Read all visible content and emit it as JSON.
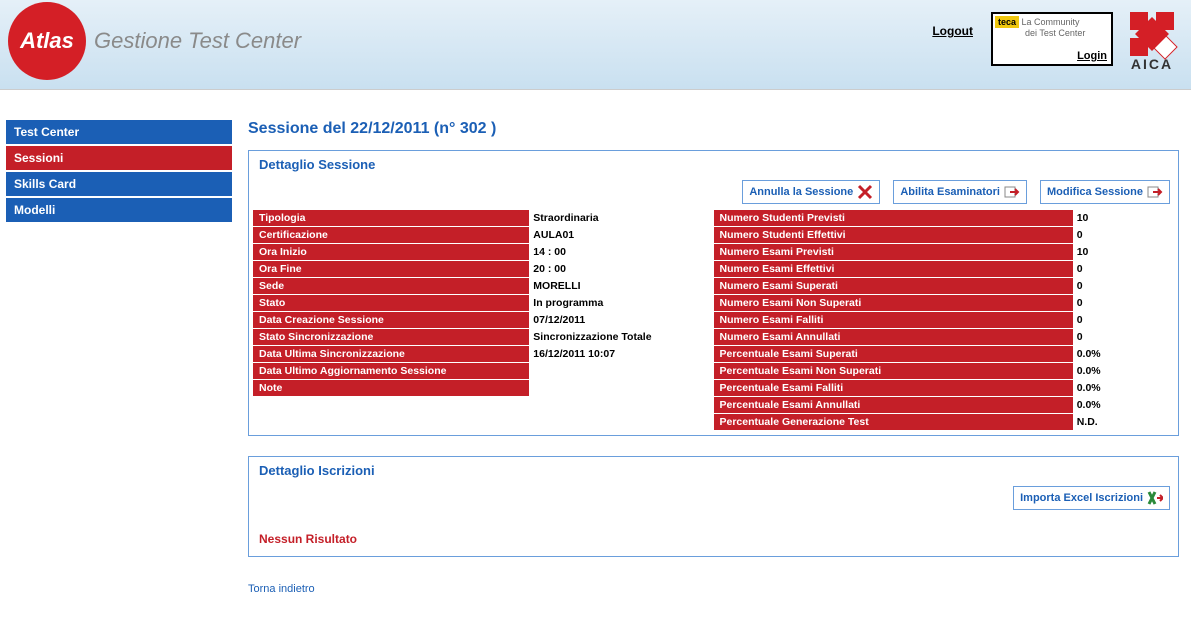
{
  "header": {
    "logo_text": "Atlas",
    "subtitle": "Gestione Test Center",
    "logout": "Logout",
    "teca_tag": "teca",
    "teca_line1": "La Community",
    "teca_line2": "dei Test Center",
    "login": "Login",
    "aica": "AICA"
  },
  "sidebar": {
    "items": [
      {
        "label": "Test Center"
      },
      {
        "label": "Sessioni"
      },
      {
        "label": "Skills Card"
      },
      {
        "label": "Modelli"
      }
    ]
  },
  "page": {
    "title": "Sessione del 22/12/2011 (n° 302        )"
  },
  "panel1": {
    "title": "Dettaglio Sessione",
    "buttons": {
      "annulla": "Annulla la Sessione",
      "abilita": "Abilita Esaminatori",
      "modifica": "Modifica Sessione"
    },
    "left": [
      {
        "label": "Tipologia",
        "value": "Straordinaria"
      },
      {
        "label": "Certificazione",
        "value": "AULA01"
      },
      {
        "label": "Ora Inizio",
        "value": "14 : 00"
      },
      {
        "label": "Ora Fine",
        "value": "20 : 00"
      },
      {
        "label": "Sede",
        "value": "MORELLI"
      },
      {
        "label": "Stato",
        "value": "In programma"
      },
      {
        "label": "Data Creazione Sessione",
        "value": "07/12/2011"
      },
      {
        "label": "Stato Sincronizzazione",
        "value": "Sincronizzazione Totale"
      },
      {
        "label": "Data Ultima Sincronizzazione",
        "value": "16/12/2011 10:07"
      },
      {
        "label": "Data Ultimo Aggiornamento Sessione",
        "value": ""
      },
      {
        "label": "Note",
        "value": ""
      },
      {
        "label": "",
        "value": ""
      }
    ],
    "right": [
      {
        "label": "Numero Studenti Previsti",
        "value": "10"
      },
      {
        "label": "Numero Studenti Effettivi",
        "value": "0"
      },
      {
        "label": "Numero Esami Previsti",
        "value": "10"
      },
      {
        "label": "Numero Esami Effettivi",
        "value": "0"
      },
      {
        "label": "Numero Esami Superati",
        "value": "0"
      },
      {
        "label": "Numero Esami Non Superati",
        "value": "0"
      },
      {
        "label": "Numero Esami Falliti",
        "value": "0"
      },
      {
        "label": "Numero Esami Annullati",
        "value": "0"
      },
      {
        "label": "Percentuale Esami Superati",
        "value": "0.0%"
      },
      {
        "label": "Percentuale Esami Non Superati",
        "value": "0.0%"
      },
      {
        "label": "Percentuale Esami Falliti",
        "value": "0.0%"
      },
      {
        "label": "Percentuale Esami Annullati",
        "value": "0.0%"
      },
      {
        "label": "Percentuale Generazione Test",
        "value": "N.D."
      }
    ]
  },
  "panel2": {
    "title": "Dettaglio Iscrizioni",
    "import_btn": "Importa Excel Iscrizioni",
    "noresult": "Nessun Risultato"
  },
  "back": "Torna indietro"
}
